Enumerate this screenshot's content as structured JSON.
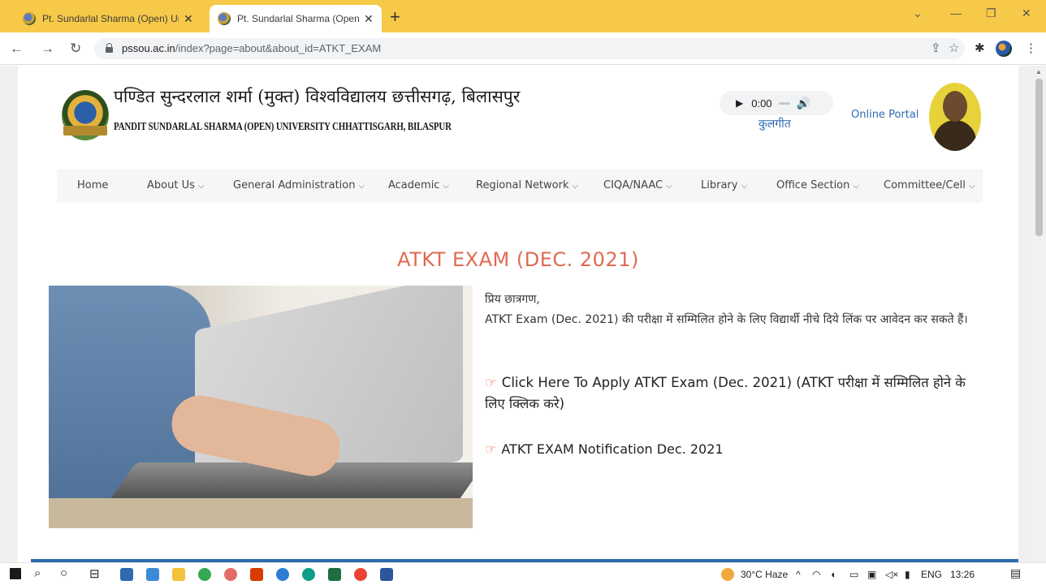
{
  "browser": {
    "tabs": [
      {
        "title": "Pt. Sundarlal Sharma (Open) Univ"
      },
      {
        "title": "Pt. Sundarlal Sharma (Open) Univ"
      }
    ],
    "url_host": "pssou.ac.in",
    "url_path": "/index?page=about&about_id=ATKT_EXAM",
    "accent_color": "#f7c948"
  },
  "site": {
    "hindi_name": "पण्डित सुन्दरलाल शर्मा (मुक्त) विश्वविद्यालय छत्तीसगढ़, बिलासपुर",
    "english_name": "PANDIT SUNDARLAL SHARMA (OPEN) UNIVERSITY CHHATTISGARH, BILASPUR",
    "audio_time": "0:00",
    "audio_label": "कुलगीत",
    "online_portal": "Online Portal"
  },
  "menu": [
    {
      "label": "Home",
      "dropdown": false
    },
    {
      "label": "About Us",
      "dropdown": true
    },
    {
      "label": "General Administration",
      "dropdown": true
    },
    {
      "label": "Academic",
      "dropdown": true
    },
    {
      "label": "Regional Network",
      "dropdown": true
    },
    {
      "label": "CIQA/NAAC",
      "dropdown": true
    },
    {
      "label": "Library",
      "dropdown": true
    },
    {
      "label": "Office Section",
      "dropdown": true
    },
    {
      "label": "Committee/Cell",
      "dropdown": true
    }
  ],
  "content": {
    "title": "ATKT EXAM (DEC. 2021)",
    "greeting": "प्रिय छात्रगण,",
    "paragraph": "ATKT Exam (Dec. 2021) की परीक्षा में सम्मिलित होने के लिए विद्यार्थी नीचे दिये लिंक पर आवेदन कर सकते हैं।",
    "apply_link": "Click Here To Apply ATKT Exam (Dec. 2021) (ATKT परीक्षा में सम्मिलित होने के लिए क्लिक करे)",
    "notification_link": "ATKT EXAM Notification Dec. 2021",
    "title_color": "#e06a52"
  },
  "taskbar": {
    "weather": "30°C Haze",
    "language": "ENG",
    "time": "13:26"
  }
}
